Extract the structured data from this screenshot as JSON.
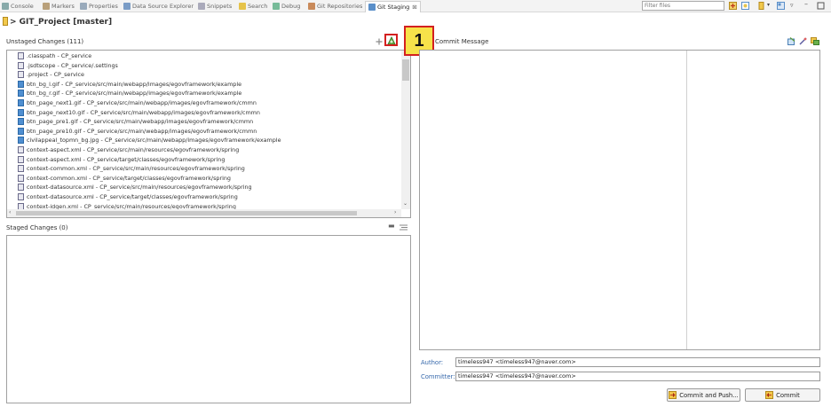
{
  "tabs": [
    {
      "label": "Console",
      "icon": "console-icon"
    },
    {
      "label": "Markers",
      "icon": "markers-icon"
    },
    {
      "label": "Properties",
      "icon": "properties-icon"
    },
    {
      "label": "Data Source Explorer",
      "icon": "data-source-icon"
    },
    {
      "label": "Snippets",
      "icon": "snippets-icon"
    },
    {
      "label": "Search",
      "icon": "search-icon"
    },
    {
      "label": "Debug",
      "icon": "debug-icon"
    },
    {
      "label": "Git Repositories",
      "icon": "git-repositories-icon"
    },
    {
      "label": "Git Staging",
      "icon": "git-staging-icon",
      "active": true
    }
  ],
  "tab_close": "⊠",
  "filter": {
    "placeholder": "Filter files"
  },
  "title": {
    "repo": "> GIT_Project [master]"
  },
  "unstaged": {
    "header": "Unstaged Changes (111)",
    "files": [
      ".classpath - CP_service",
      ".jsdtscope - CP_service/.settings",
      ".project - CP_service",
      "btn_bg_l.gif - CP_service/src/main/webapp/images/egovframework/example",
      "btn_bg_r.gif - CP_service/src/main/webapp/images/egovframework/example",
      "btn_page_next1.gif - CP_service/src/main/webapp/images/egovframework/cmmn",
      "btn_page_next10.gif - CP_service/src/main/webapp/images/egovframework/cmmn",
      "btn_page_pre1.gif - CP_service/src/main/webapp/images/egovframework/cmmn",
      "btn_page_pre10.gif - CP_service/src/main/webapp/images/egovframework/cmmn",
      "civilappeal_topmn_bg.jpg - CP_service/src/main/webapp/images/egovframework/example",
      "context-aspect.xml - CP_service/src/main/resources/egovframework/spring",
      "context-aspect.xml - CP_service/target/classes/egovframework/spring",
      "context-common.xml - CP_service/src/main/resources/egovframework/spring",
      "context-common.xml - CP_service/target/classes/egovframework/spring",
      "context-datasource.xml - CP_service/src/main/resources/egovframework/spring",
      "context-datasource.xml - CP_service/target/classes/egovframework/spring",
      "context-idgen.xml - CP_service/src/main/resources/egovframework/spring"
    ],
    "file_types": [
      "doc",
      "doc",
      "doc",
      "img",
      "img",
      "img",
      "img",
      "img",
      "img",
      "img",
      "doc",
      "doc",
      "doc",
      "doc",
      "doc",
      "doc",
      "doc"
    ]
  },
  "staged": {
    "header": "Staged Changes (0)"
  },
  "commit": {
    "header": "Commit Message",
    "author_label": "Author:",
    "author_value": "timeless947 <timeless947@naver.com>",
    "committer_label": "Committer:",
    "committer_value": "timeless947 <timeless947@naver.com>",
    "commit_push_label": "Commit and Push...",
    "commit_label": "Commit"
  },
  "marker": {
    "number": "1"
  },
  "colors": {
    "highlight": "#d32020",
    "marker_bg": "#f7e24a",
    "field_label": "#3366aa"
  }
}
